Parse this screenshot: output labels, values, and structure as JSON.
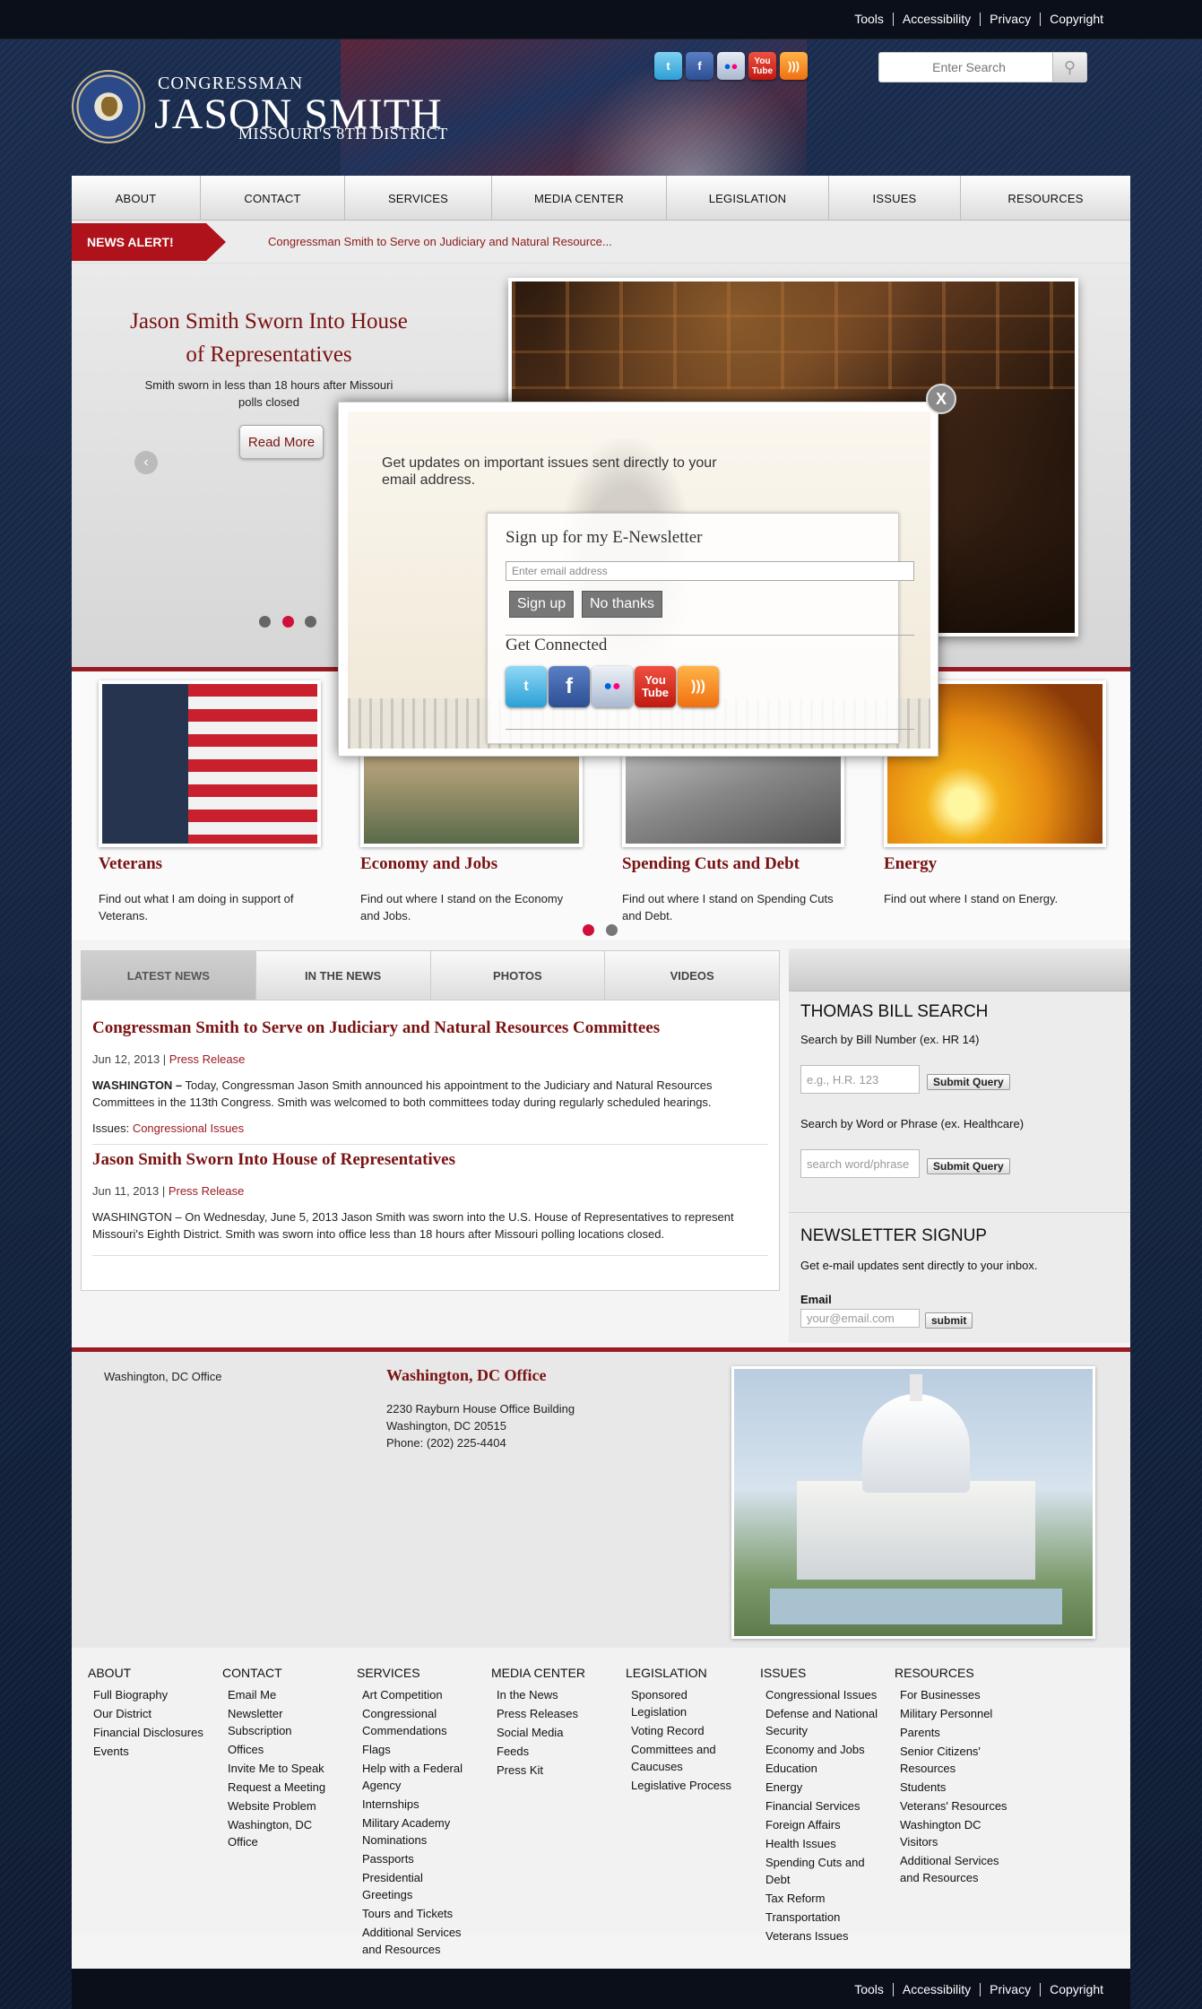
{
  "utility_links": [
    "Tools",
    "Accessibility",
    "Privacy",
    "Copyright"
  ],
  "brand": {
    "line1": "CONGRESSMAN",
    "name": "JASON SMITH",
    "district": "MISSOURI'S 8TH DISTRICT"
  },
  "social_icons": [
    "twitter-icon",
    "facebook-icon",
    "flickr-icon",
    "youtube-icon",
    "rss-icon"
  ],
  "search": {
    "placeholder": "Enter Search"
  },
  "nav": [
    "ABOUT",
    "CONTACT",
    "SERVICES",
    "MEDIA CENTER",
    "LEGISLATION",
    "ISSUES",
    "RESOURCES"
  ],
  "alert": {
    "tag": "NEWS ALERT!",
    "text": "Congressman Smith to Serve on Judiciary and Natural Resource..."
  },
  "slide": {
    "title": "Jason Smith Sworn Into House of Representatives",
    "subtitle": "Smith sworn in less than 18 hours after Missouri polls closed",
    "button": "Read More"
  },
  "issues": [
    {
      "title": "Veterans",
      "text": "Find out what I am doing in support of Veterans."
    },
    {
      "title": "Economy and Jobs",
      "text": "Find out where I stand on the Economy and Jobs."
    },
    {
      "title": "Spending Cuts and Debt",
      "text": "Find out where I stand on Spending Cuts and Debt."
    },
    {
      "title": "Energy",
      "text": "Find out where I stand on Energy."
    }
  ],
  "news_tabs": [
    "LATEST NEWS",
    "IN THE NEWS",
    "PHOTOS",
    "VIDEOS"
  ],
  "articles": [
    {
      "title": "Congressman Smith to Serve on Judiciary and Natural Resources Committees",
      "date": "Jun 12, 2013",
      "type": "Press Release",
      "lead": "WASHINGTON –",
      "body": " Today, Congressman Jason Smith announced his appointment to the Judiciary and Natural Resources Committees in the 113th Congress. Smith was welcomed to both committees today during regularly scheduled hearings.",
      "issues_label": "Issues:",
      "issues_value": "Congressional Issues"
    },
    {
      "title": "Jason Smith Sworn Into House of Representatives",
      "date": "Jun 11, 2013",
      "type": "Press Release",
      "body": "WASHINGTON – On Wednesday, June 5, 2013 Jason Smith was sworn into the U.S. House of Representatives to represent Missouri's Eighth District. Smith was sworn into office less than 18 hours after Missouri polling locations closed."
    }
  ],
  "bill_search": {
    "title": "THOMAS BILL SEARCH",
    "label1": "Search by Bill Number (ex. HR 14)",
    "placeholder1": "e.g., H.R. 123",
    "button": "Submit Query",
    "label2": "Search by Word or Phrase (ex. Healthcare)",
    "placeholder2": "search word/phrase"
  },
  "newsletter": {
    "title": "NEWSLETTER SIGNUP",
    "text": "Get e-mail updates sent directly to your inbox.",
    "email_label": "Email",
    "placeholder": "your@email.com",
    "button": "submit"
  },
  "office": {
    "sidebar_label": "Washington, DC Office",
    "title": "Washington, DC Office",
    "address1": "2230 Rayburn House Office Building",
    "address2": "Washington, DC 20515",
    "phone": "Phone: (202) 225-4404"
  },
  "sitemap": [
    {
      "heading": "ABOUT",
      "items": [
        "Full Biography",
        "Our District",
        "Financial Disclosures",
        "Events"
      ]
    },
    {
      "heading": "CONTACT",
      "items": [
        "Email Me",
        "Newsletter Subscription",
        "Offices",
        "Invite Me to Speak",
        "Request a Meeting",
        "Website Problem",
        "Washington, DC Office"
      ]
    },
    {
      "heading": "SERVICES",
      "items": [
        "Art Competition",
        "Congressional Commendations",
        "Flags",
        "Help with a Federal Agency",
        "Internships",
        "Military Academy Nominations",
        "Passports",
        "Presidential Greetings",
        "Tours and Tickets",
        "Additional Services and Resources"
      ]
    },
    {
      "heading": "MEDIA CENTER",
      "items": [
        "In the News",
        "Press Releases",
        "Social Media",
        "Feeds",
        "Press Kit"
      ]
    },
    {
      "heading": "LEGISLATION",
      "items": [
        "Sponsored Legislation",
        "Voting Record",
        "Committees and Caucuses",
        "Legislative Process"
      ]
    },
    {
      "heading": "ISSUES",
      "items": [
        "Congressional Issues",
        "Defense and National Security",
        "Economy and Jobs",
        "Education",
        "Energy",
        "Financial Services",
        "Foreign Affairs",
        "Health Issues",
        "Spending Cuts and Debt",
        "Tax Reform",
        "Transportation",
        "Veterans Issues"
      ]
    },
    {
      "heading": "RESOURCES",
      "items": [
        "For Businesses",
        "Military Personnel",
        "Parents",
        "Senior Citizens' Resources",
        "Students",
        "Veterans' Resources",
        "Washington DC Visitors",
        "Additional Services and Resources"
      ]
    }
  ],
  "modal": {
    "text": "Get updates on important issues sent directly to your email address.",
    "heading": "Sign up for my E-Newsletter",
    "email_placeholder": "Enter email address",
    "signup": "Sign up",
    "nothanks": "No thanks",
    "connected": "Get Connected",
    "close": "X",
    "social": [
      "twitter-icon",
      "facebook-icon",
      "flickr-icon",
      "youtube-icon",
      "rss-icon"
    ]
  },
  "colors": {
    "accent": "#9b1b23",
    "title_red": "#7a1212",
    "navy": "#13243f"
  }
}
